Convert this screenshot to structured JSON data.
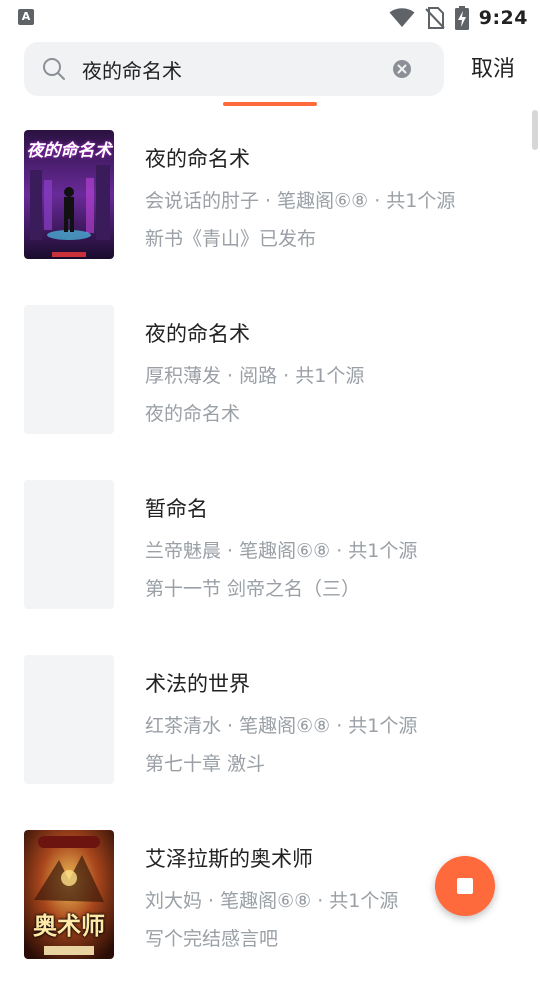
{
  "status_bar": {
    "app_icon_letter": "A",
    "time": "9:24",
    "icons": [
      "wifi-icon",
      "no-sim-icon",
      "battery-charging-icon"
    ]
  },
  "search": {
    "query": "夜的命名术",
    "search_icon": "search-icon",
    "clear_icon": "clear-circle-icon",
    "cancel_label": "取消"
  },
  "results": [
    {
      "title": "夜的命名术",
      "meta": "会说话的肘子 · 笔趣阁⑥⑧ · 共1个源",
      "latest": "新书《青山》已发布",
      "cover_title_text": "夜的命名术"
    },
    {
      "title": "夜的命名术",
      "meta": "厚积薄发 · 阅路 · 共1个源",
      "latest": "夜的命名术"
    },
    {
      "title": "暂命名",
      "meta": "兰帝魅晨 · 笔趣阁⑥⑧ · 共1个源",
      "latest": "第十一节 剑帝之名（三）"
    },
    {
      "title": "术法的世界",
      "meta": "红茶清水 · 笔趣阁⑥⑧ · 共1个源",
      "latest": "第七十章 激斗"
    },
    {
      "title": "艾泽拉斯的奥术师",
      "meta": "刘大妈 · 笔趣阁⑥⑧ · 共1个源",
      "latest": "写个完结感言吧",
      "cover_title_text": "奥术师"
    }
  ],
  "fab": {
    "icon": "stop-icon"
  },
  "colors": {
    "accent": "#ff6a3d",
    "secondary_text": "#9aa0a6",
    "search_bg": "#f1f2f4",
    "placeholder_cover": "#f3f4f6"
  }
}
